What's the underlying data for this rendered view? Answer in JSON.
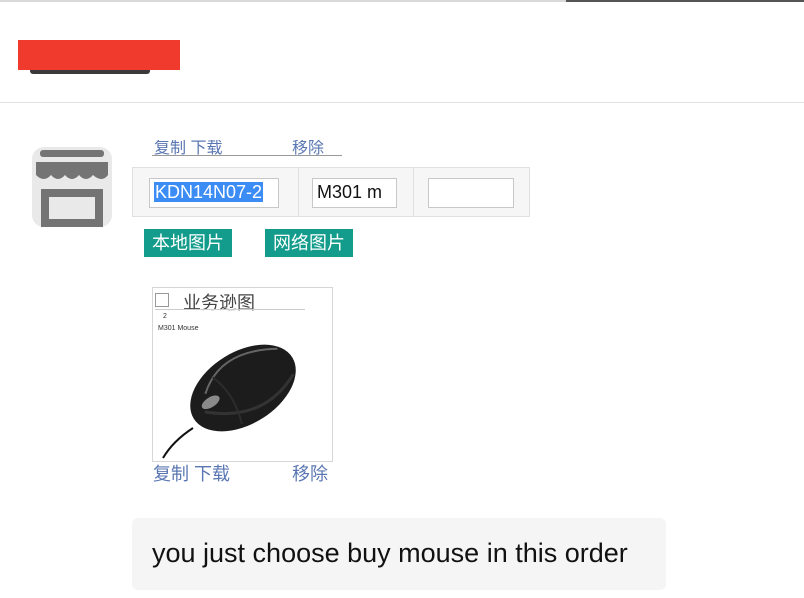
{
  "header": {
    "title_redacted": true
  },
  "avatar": {
    "icon": "store-icon"
  },
  "form": {
    "top_links": {
      "copy_download": "复制 下载",
      "remove": "移除"
    },
    "fields": [
      {
        "value": "KDN14N07-2",
        "selected": true
      },
      {
        "value": "M301 m"
      },
      {
        "value": ""
      }
    ],
    "buttons": {
      "local_image": "本地图片",
      "web_image": "网络图片"
    }
  },
  "image_card": {
    "checkbox_label": "业务逊图",
    "caption_number": "2",
    "caption_text": "M301 Mouse",
    "image_icon": "mouse-photo",
    "links": {
      "copy_download": "复制 下载",
      "remove": "移除"
    }
  },
  "message": {
    "text": "you just choose buy mouse in this order"
  },
  "colors": {
    "button_teal": "#139c8c",
    "link_blue": "#5b77b3",
    "redaction_red": "#f03a2e",
    "selection_blue": "#3b8cf5"
  }
}
